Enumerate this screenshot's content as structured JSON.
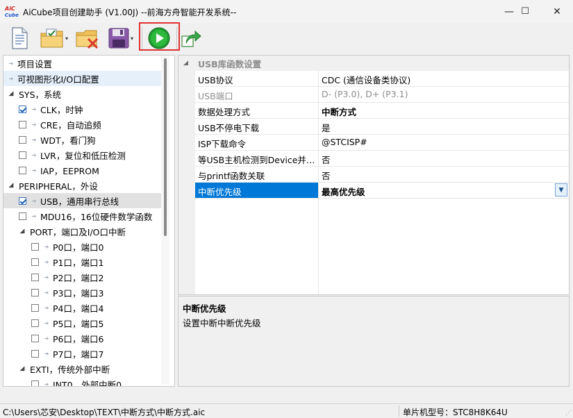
{
  "window": {
    "logo_top": "AiC",
    "logo_bottom": "Cube",
    "title": "AiCube项目创建助手 (V1.00J) --前海方舟智能开发系统--",
    "minimize": "—",
    "maximize": "☐",
    "close": "✕"
  },
  "toolbar": {
    "dropdown_arrow": "▾"
  },
  "tree": [
    {
      "label": "项目设置",
      "level": 0,
      "kind": "leaf-arrow"
    },
    {
      "label": "可视图形化I/O口配置",
      "level": 0,
      "kind": "leaf-arrow",
      "state": "hover"
    },
    {
      "label": "SYS，系统",
      "level": 0,
      "kind": "group"
    },
    {
      "label": "CLK，时钟",
      "level": 1,
      "kind": "check",
      "checked": true
    },
    {
      "label": "CRE，自动追频",
      "level": 1,
      "kind": "check",
      "checked": false
    },
    {
      "label": "WDT，看门狗",
      "level": 1,
      "kind": "check",
      "checked": false
    },
    {
      "label": "LVR，复位和低压检测",
      "level": 1,
      "kind": "check",
      "checked": false
    },
    {
      "label": "IAP，EEPROM",
      "level": 1,
      "kind": "check",
      "checked": false
    },
    {
      "label": "PERIPHERAL，外设",
      "level": 0,
      "kind": "group"
    },
    {
      "label": "USB，通用串行总线",
      "level": 1,
      "kind": "check",
      "checked": true,
      "state": "selected"
    },
    {
      "label": "MDU16，16位硬件数学函数",
      "level": 1,
      "kind": "check",
      "checked": false
    },
    {
      "label": "PORT，端口及I/O口中断",
      "level": 1,
      "kind": "group"
    },
    {
      "label": "P0口，端口0",
      "level": 2,
      "kind": "check",
      "checked": false
    },
    {
      "label": "P1口，端口1",
      "level": 2,
      "kind": "check",
      "checked": false
    },
    {
      "label": "P2口，端口2",
      "level": 2,
      "kind": "check",
      "checked": false
    },
    {
      "label": "P3口，端口3",
      "level": 2,
      "kind": "check",
      "checked": false
    },
    {
      "label": "P4口，端口4",
      "level": 2,
      "kind": "check",
      "checked": false
    },
    {
      "label": "P5口，端口5",
      "level": 2,
      "kind": "check",
      "checked": false
    },
    {
      "label": "P6口，端口6",
      "level": 2,
      "kind": "check",
      "checked": false
    },
    {
      "label": "P7口，端口7",
      "level": 2,
      "kind": "check",
      "checked": false
    },
    {
      "label": "EXTI，传统外部中断",
      "level": 1,
      "kind": "group"
    },
    {
      "label": "INT0，外部中断0",
      "level": 2,
      "kind": "check",
      "checked": false
    }
  ],
  "property_grid": {
    "category": "USB库函数设置",
    "rows": [
      {
        "name": "USB协议",
        "value": "CDC (通信设备类协议)"
      },
      {
        "name": "USB端口",
        "value": "D- (P3.0), D+ (P3.1)",
        "disabled": true
      },
      {
        "name": "数据处理方式",
        "value": "中断方式",
        "bold": true
      },
      {
        "name": "USB不停电下载",
        "value": "是"
      },
      {
        "name": "ISP下载命令",
        "value": "@STCISP#"
      },
      {
        "name": "等USB主机检测到Device并配置完成",
        "value": "否"
      },
      {
        "name": "与printf函数关联",
        "value": "否"
      },
      {
        "name": "中断优先级",
        "value": "最高优先级",
        "bold": true,
        "selected": true
      }
    ]
  },
  "description": {
    "title": "中断优先级",
    "text": "设置中断中断优先级"
  },
  "status": {
    "path": "C:\\Users\\芯安\\Desktop\\TEXT\\中断方式\\中断方式.aic",
    "model": "单片机型号：STC8H8K64U"
  }
}
